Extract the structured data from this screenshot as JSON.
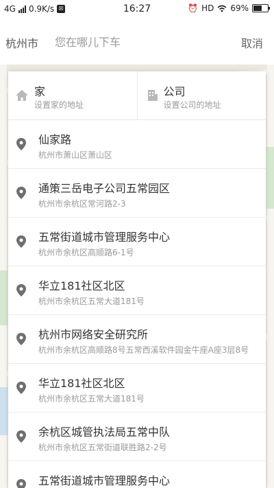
{
  "status_bar": {
    "network": "4G",
    "speed": "0.9K/s",
    "time": "16:27",
    "hd": "HD",
    "battery": "69%",
    "battery_level": 0.69
  },
  "header": {
    "city": "杭州市",
    "search_placeholder": "您在哪儿下车",
    "cancel": "取消"
  },
  "quick": {
    "home": {
      "title": "家",
      "subtitle": "设置家的地址",
      "icon": "home-icon"
    },
    "company": {
      "title": "公司",
      "subtitle": "设置公司的地址",
      "icon": "building-icon"
    }
  },
  "places": [
    {
      "name": "仙家路",
      "address": "杭州市萧山区萧山区"
    },
    {
      "name": "通策三岳电子公司五常园区",
      "address": "杭州市余杭区常河路2-3"
    },
    {
      "name": "五常街道城市管理服务中心",
      "address": "杭州市余杭区高顺路6-1号"
    },
    {
      "name": "华立181社区北区",
      "address": "杭州市余杭区五常大道181号"
    },
    {
      "name": "杭州市网络安全研究所",
      "address": "杭州市余杭区高顺路8号五常西溪软件园金牛座A座3层8号"
    },
    {
      "name": "华立181社区北区",
      "address": "杭州市余杭区五常大道181号"
    },
    {
      "name": "余杭区城管执法局五常中队",
      "address": "杭州市余杭区五常街道联胜路2-2号"
    },
    {
      "name": "五常街道城市管理服务中心",
      "address": ""
    }
  ],
  "colors": {
    "icon_gray": "#6f6f6f",
    "text_main": "#333333",
    "text_sub": "#9a9a9a"
  }
}
